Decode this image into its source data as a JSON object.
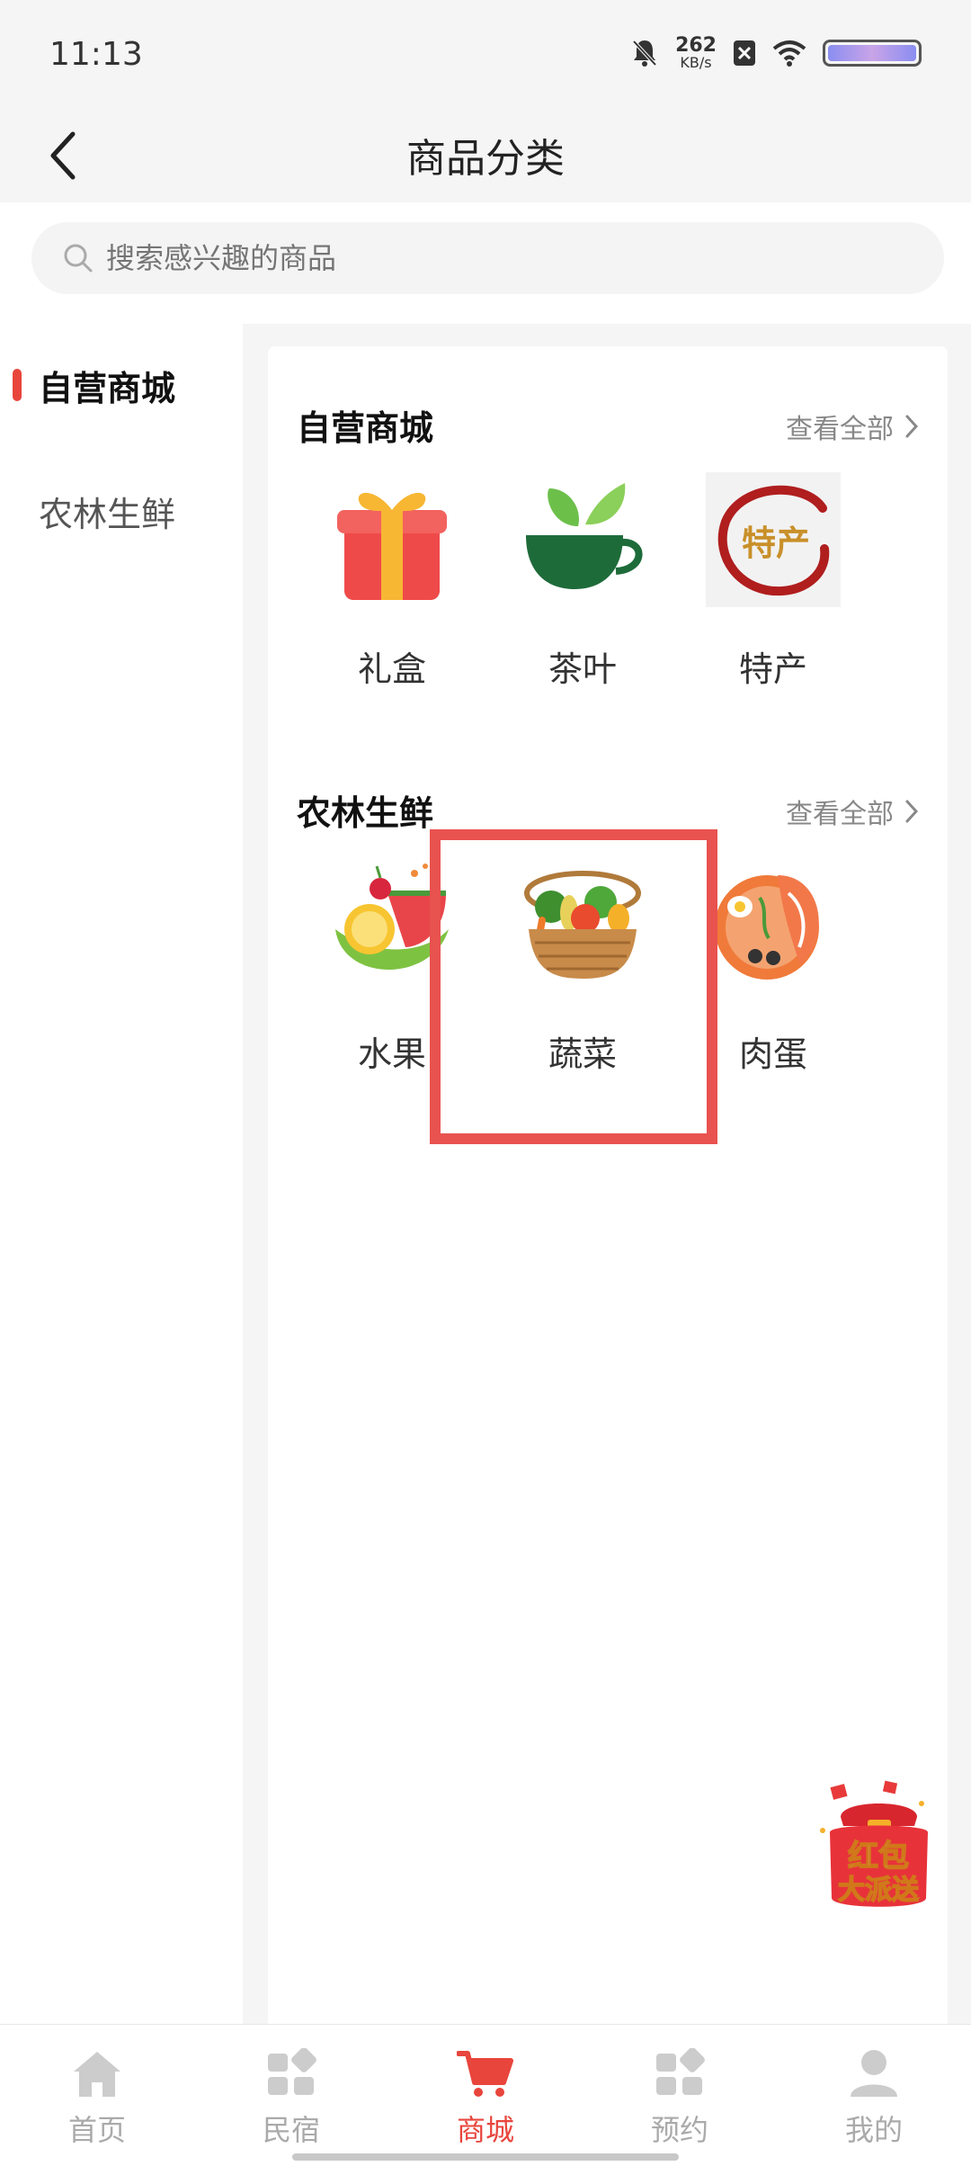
{
  "status_bar": {
    "time": "11:13",
    "speed_value": "262",
    "speed_unit": "KB/s",
    "battery_color": "#a8a2ee"
  },
  "header": {
    "title": "商品分类",
    "back_icon": "chevron-left-icon"
  },
  "search": {
    "placeholder": "搜索感兴趣的商品",
    "value": ""
  },
  "sidebar": {
    "items": [
      {
        "label": "自营商城",
        "active": true
      },
      {
        "label": "农林生鲜",
        "active": false
      }
    ]
  },
  "sections": [
    {
      "title": "自营商城",
      "view_all": "查看全部",
      "items": [
        {
          "label": "礼盒",
          "icon": "gift-box-icon"
        },
        {
          "label": "茶叶",
          "icon": "tea-cup-icon"
        },
        {
          "label": "特产",
          "icon": "specialty-seal-icon",
          "icon_text": "特产"
        }
      ]
    },
    {
      "title": "农林生鲜",
      "view_all": "查看全部",
      "items": [
        {
          "label": "水果",
          "icon": "fruit-icon"
        },
        {
          "label": "蔬菜",
          "icon": "vegetable-basket-icon",
          "highlighted": true
        },
        {
          "label": "肉蛋",
          "icon": "meat-egg-icon"
        }
      ]
    }
  ],
  "floating": {
    "red_packet_line1": "红包",
    "red_packet_line2": "大派送"
  },
  "bottom_nav": [
    {
      "label": "首页",
      "icon": "home-icon",
      "active": false
    },
    {
      "label": "民宿",
      "icon": "grid-icon",
      "active": false
    },
    {
      "label": "商城",
      "icon": "cart-icon",
      "active": true
    },
    {
      "label": "预约",
      "icon": "grid-icon",
      "active": false
    },
    {
      "label": "我的",
      "icon": "user-icon",
      "active": false
    }
  ],
  "colors": {
    "accent": "#e8453c",
    "highlight_border": "#e8524f",
    "muted_text": "#aaaaaa",
    "background": "#f5f5f5"
  }
}
